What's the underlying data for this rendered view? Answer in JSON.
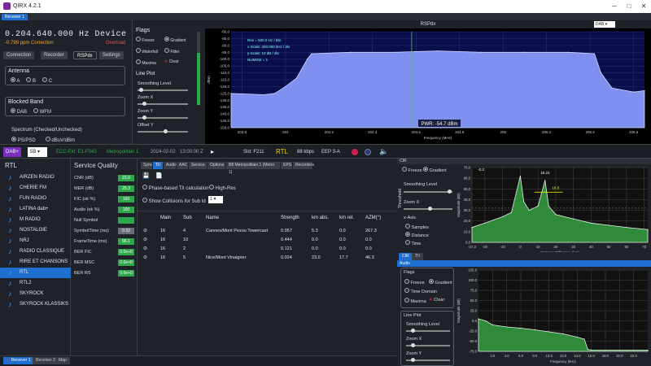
{
  "app": {
    "title": "QIRX 4.2.1",
    "icon": "app-icon"
  },
  "window": {
    "minimize": "─",
    "maximize": "□",
    "close": "✕"
  },
  "receiver_tab": "Receiver 1",
  "device": {
    "frequency": "0.204.640.000 Hz Device",
    "correction": "-0.799 ppm Correction",
    "overload": "Overload"
  },
  "left_tabs": [
    "Connection",
    "Recorder",
    "RSPdx",
    "Settings"
  ],
  "antenna": {
    "title": "Antenna",
    "options": [
      "A",
      "B",
      "C"
    ],
    "selected": 0
  },
  "blocked_band": {
    "title": "Blocked Band",
    "options": [
      "DAB",
      "WFM"
    ],
    "selected": 0
  },
  "spectrum_mode": {
    "title": "Spectrum (Checked/Unchecked)",
    "options": [
      "PS/PSD",
      "dBuV/dBm"
    ],
    "selected": 0
  },
  "flags": {
    "title": "Flags",
    "items": [
      {
        "label": "Freeze",
        "on": false
      },
      {
        "label": "Gradient",
        "on": true
      },
      {
        "label": "Waterfall",
        "on": false
      },
      {
        "label": "Filter",
        "on": false
      },
      {
        "label": "Maxima",
        "on": false
      },
      {
        "label": "Clear",
        "on": false
      }
    ]
  },
  "lineplot": {
    "title": "Line Plot",
    "controls": [
      "Smoothing Level",
      "Zoom X",
      "Zoom Y",
      "Offset Y"
    ]
  },
  "spectrum": {
    "title": "RSPdx",
    "dropdown": "DAB",
    "annotations": [
      "Res = 500,0 Hz / Bin",
      "x-Scale: 200,000 kHz / div",
      "y-Scale: 10 dB / div",
      "NUMSW = 1"
    ],
    "power": "PWR: -54.7 dBm",
    "xlabel": "Frequency (MHz)",
    "ylabel": "dBm"
  },
  "chart_data": [
    {
      "type": "area",
      "title": "RSPdx",
      "xlabel": "Frequency (MHz)",
      "ylabel": "dBm",
      "xlim": [
        203.75,
        205.65
      ],
      "ylim": [
        -150,
        -80
      ],
      "xticks": [
        "203.8",
        "204",
        "204.2",
        "204.4",
        "204.6",
        "204.8",
        "205",
        "205.2",
        "205.4",
        "205.6"
      ],
      "yticks": [
        "-80,0",
        "-85,0",
        "-90,0",
        "-95,0",
        "-100,0",
        "-105,0",
        "-110,0",
        "-115,0",
        "-120,0",
        "-125,0",
        "-130,0",
        "-135,0",
        "-140,0",
        "-145,0",
        "-150,0"
      ],
      "series": [
        {
          "x": [
            203.75,
            203.9,
            203.95,
            204.0,
            204.05,
            204.1,
            204.12,
            204.3,
            204.5,
            204.7,
            204.9,
            205.1,
            205.3,
            205.42,
            205.45,
            205.5,
            205.6,
            205.65
          ],
          "y": [
            -125,
            -126,
            -125,
            -120,
            -114,
            -100,
            -96,
            -95,
            -95,
            -94,
            -95,
            -95,
            -95,
            -96,
            -110,
            -121,
            -124,
            -123
          ]
        }
      ]
    },
    {
      "type": "area",
      "title": "CIR",
      "xlabel": "Distance Difference (km)",
      "ylabel": "Magnitude (dB)",
      "xlim": [
        -27.3,
        72
      ],
      "ylim": [
        0,
        70
      ],
      "xticks": [
        "-27,3",
        "-20",
        "-10",
        "0",
        "10",
        "20",
        "30",
        "40",
        "50",
        "60",
        "70"
      ],
      "yticks": [
        "70,0",
        "60,0",
        "50,0",
        "40,0",
        "30,0",
        "20,0",
        "10,0",
        "0,0"
      ],
      "series": [
        {
          "x": [
            -27.3,
            -20,
            -10,
            -5,
            0,
            2,
            5,
            10,
            14,
            16,
            20,
            30,
            40,
            50,
            60,
            72
          ],
          "y": [
            14,
            18,
            24,
            28,
            62,
            38,
            30,
            34,
            58,
            34,
            26,
            22,
            18,
            16,
            14,
            12
          ]
        }
      ]
    },
    {
      "type": "area",
      "title": "Audio",
      "xlabel": "Frequency (kHz)",
      "ylabel": "Magnitude (dB)",
      "xlim": [
        0,
        24
      ],
      "ylim": [
        -75,
        125
      ],
      "xticks": [
        "2.0",
        "4.0",
        "6.0",
        "8.0",
        "10.0",
        "12.0",
        "14.0",
        "16.0",
        "18.0",
        "20.0",
        "22.0"
      ],
      "yticks": [
        "125.0",
        "100.0",
        "75.0",
        "50.0",
        "25.0",
        "0.0",
        "-25.0",
        "-50.0",
        "-75.0"
      ],
      "series": [
        {
          "x": [
            0,
            1,
            2,
            4,
            6,
            8,
            10,
            12,
            14,
            15,
            15.5,
            16,
            24
          ],
          "y": [
            5,
            0,
            -10,
            -15,
            -18,
            -22,
            -27,
            -32,
            -40,
            -45,
            -70,
            -72,
            -72
          ]
        }
      ]
    }
  ],
  "status": {
    "mode": "DAB+",
    "channel": "5B",
    "ensemble": "ECC-Ekt: E1-F043",
    "name": "Metropolitain 1",
    "date": "2024-02-02",
    "time": "13:00:00 Z",
    "sid": "SId: F211",
    "service": "RTL",
    "bitrate": "88 kbps",
    "eep": "EEP 3-A"
  },
  "stations": {
    "title": "RTL",
    "items": [
      "AIRZEN RADIO",
      "CHERIE FM",
      "FUN RADIO",
      "LATINA dab+",
      "M RADIO",
      "NOSTALGIE",
      "NRJ",
      "RADIO CLASSIQUE",
      "RIRE ET CHANSONS",
      "RTL",
      "RTL2",
      "SKYROCK",
      "SKYROCK KLASSIKS"
    ],
    "selected": 9
  },
  "service_quality": {
    "title": "Service Quality",
    "rows": [
      {
        "label": "CNR (dB)",
        "value": "23.0"
      },
      {
        "label": "MER (dB)",
        "value": "25.3"
      },
      {
        "label": "FIC (ok %)",
        "value": "100"
      },
      {
        "label": "Audio (ok %)",
        "value": "100"
      },
      {
        "label": "Null Symbol",
        "value": ""
      },
      {
        "label": "SymbolTime (ms)",
        "value": "0.32"
      },
      {
        "label": "FrameTime (ms)",
        "value": "96.1"
      },
      {
        "label": "BER FIC",
        "value": "0.0e+0"
      },
      {
        "label": "BER MSC",
        "value": "0.0e+0"
      },
      {
        "label": "BER RS",
        "value": "0.0e+0"
      }
    ]
  },
  "tii": {
    "tabs": [
      "Sync",
      "TII",
      "Audio",
      "AAC",
      "Service",
      "Options",
      "B8 Metropolitain 1 (Metro 1)",
      "EPG",
      "Recorders"
    ],
    "active": 1,
    "phase": "Phase-based TII calculation",
    "highres": "High-Res",
    "collisions": "Show Collisions for Sub Id",
    "collision_value": "1",
    "headers": [
      "Main",
      "Sub",
      "Name",
      "Strength",
      "km abs.",
      "km rel.",
      "AZM(°)"
    ],
    "rows": [
      [
        "16",
        "4",
        "Cannes/Mont Pezou Towercast",
        "0.957",
        "5.3",
        "0.0",
        "267.3"
      ],
      [
        "16",
        "10",
        "",
        "0.444",
        "0.0",
        "0.0",
        "0.0"
      ],
      [
        "16",
        "2",
        "",
        "0.121",
        "0.0",
        "0.0",
        "0.0"
      ],
      [
        "16",
        "5",
        "Nice/Mont Vinaigrier",
        "0.024",
        "23.0",
        "17.7",
        "46.3"
      ]
    ]
  },
  "cir": {
    "title": "CIR",
    "flags": [
      "Freeze",
      "Gradient"
    ],
    "smoothing": "Smoothing Level",
    "zoomx": "Zoom X",
    "xaxis": "x-Axis",
    "axis_opts": [
      "Samples",
      "Distance",
      "Time"
    ],
    "axis_sel": 1,
    "threshold": "Threshold",
    "tabs": [
      "CIR",
      "TII"
    ],
    "marker1": "16.22",
    "marker2": "-0.2",
    "marker3": "16.5",
    "left": "-27,3"
  },
  "audio": {
    "title": "Audio",
    "flags_title": "Flags",
    "flags": [
      "Freeze",
      "Gradient",
      "Time Domain",
      "Maxima",
      "Clear"
    ],
    "lineplot": "Line Plot",
    "controls": [
      "Smoothing Level",
      "Zoom X",
      "Zoom Y"
    ]
  },
  "bottom_tabs": [
    "Receiver 1",
    "Receiver 2",
    "Map"
  ],
  "colors": {
    "accent": "#1e6fd0",
    "ok": "#2ea84c",
    "spectrum": "#9aa6ff",
    "bg": "#1f2329"
  }
}
